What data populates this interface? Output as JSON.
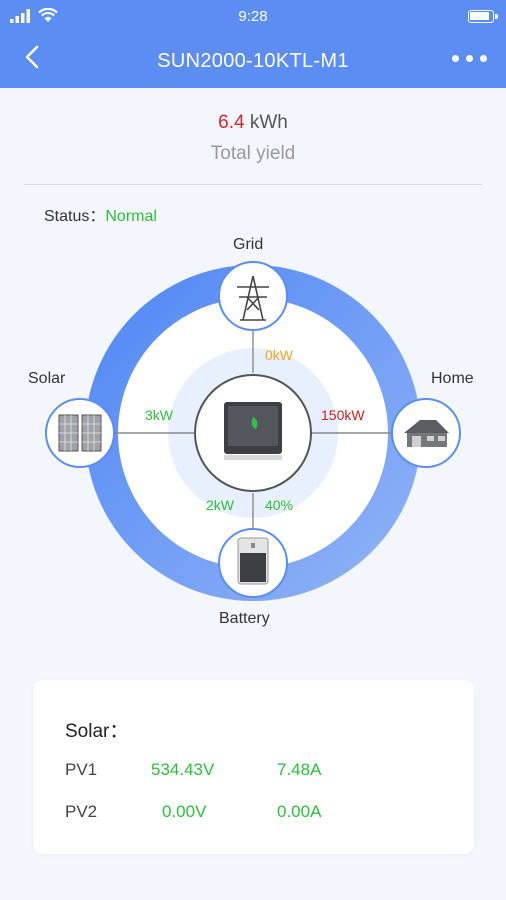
{
  "status_bar": {
    "time": "9:28"
  },
  "header": {
    "title": "SUN2000-10KTL-M1"
  },
  "yield": {
    "value": "6.4",
    "unit": "kWh",
    "label": "Total yield"
  },
  "status": {
    "label": "Status：",
    "value": "Normal"
  },
  "diagram": {
    "grid_label": "Grid",
    "solar_label": "Solar",
    "home_label": "Home",
    "battery_label": "Battery",
    "grid_power": "0kW",
    "solar_power": "3kW",
    "home_power": "150kW",
    "battery_power": "2kW",
    "battery_soc": "40%"
  },
  "solar_card": {
    "title": "Solar：",
    "rows": [
      {
        "name": "PV1",
        "voltage": "534.43V",
        "current": "7.48A"
      },
      {
        "name": "PV2",
        "voltage": "0.00V",
        "current": "0.00A"
      }
    ]
  },
  "colors": {
    "header": "#5b8df2",
    "green": "#2dbe3b",
    "red": "#d4262a",
    "orange": "#f5a623"
  }
}
